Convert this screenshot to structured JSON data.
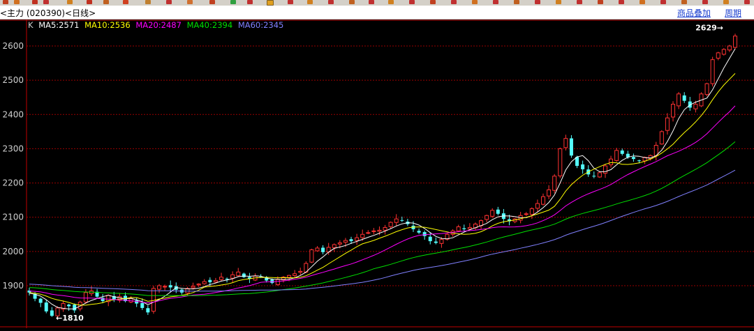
{
  "window": {
    "title": "<主力 (020390)<日线>",
    "links": [
      "商品叠加",
      "周期"
    ]
  },
  "ma_legend": {
    "k_label": "K",
    "items": [
      {
        "text": "MA5:2571",
        "color": "#ffffff"
      },
      {
        "text": "MA10:2536",
        "color": "#ffff00"
      },
      {
        "text": "MA20:2487",
        "color": "#ff00ff"
      },
      {
        "text": "MA40:2394",
        "color": "#00e000"
      },
      {
        "text": "MA60:2345",
        "color": "#8080ff"
      }
    ]
  },
  "colors": {
    "up": "#ff3232",
    "down": "#54fcfc",
    "grid": "#9a0000",
    "axis_text": "#d0d0d0"
  },
  "chart_data": {
    "type": "candlestick",
    "ylim": [
      1780,
      2690
    ],
    "yticks": [
      1900,
      2000,
      2100,
      2200,
      2300,
      2400,
      2500,
      2600
    ],
    "annotations": [
      {
        "label": "2629",
        "value": 2629,
        "side": "right"
      },
      {
        "label": "1810",
        "value": 1810,
        "side": "left"
      }
    ],
    "price_path": [
      1880,
      1862,
      1850,
      1825,
      1812,
      1835,
      1848,
      1840,
      1828,
      1852,
      1880,
      1885,
      1868,
      1855,
      1872,
      1860,
      1868,
      1855,
      1862,
      1848,
      1835,
      1822,
      1892,
      1900,
      1898,
      1895,
      1888,
      1880,
      1892,
      1898,
      1905,
      1912,
      1910,
      1915,
      1925,
      1920,
      1932,
      1940,
      1925,
      1920,
      1928,
      1925,
      1915,
      1908,
      1918,
      1925,
      1930,
      1935,
      1942,
      1965,
      2005,
      2010,
      1998,
      2012,
      2020,
      2025,
      2032,
      2030,
      2040,
      2050,
      2055,
      2060,
      2062,
      2070,
      2085,
      2095,
      2090,
      2080,
      2065,
      2055,
      2045,
      2030,
      2025,
      2035,
      2050,
      2060,
      2072,
      2065,
      2070,
      2080,
      2090,
      2105,
      2120,
      2110,
      2095,
      2088,
      2095,
      2105,
      2110,
      2125,
      2140,
      2160,
      2180,
      2220,
      2300,
      2330,
      2280,
      2250,
      2240,
      2225,
      2220,
      2230,
      2250,
      2270,
      2295,
      2285,
      2275,
      2270,
      2265,
      2275,
      2280,
      2310,
      2350,
      2390,
      2430,
      2460,
      2440,
      2420,
      2430,
      2460,
      2490,
      2560,
      2580,
      2590,
      2600,
      2629
    ],
    "ma5_end": 2571,
    "ma10_end": 2536,
    "ma20_end": 2487,
    "ma40_end": 2394,
    "ma60_end": 2345
  }
}
